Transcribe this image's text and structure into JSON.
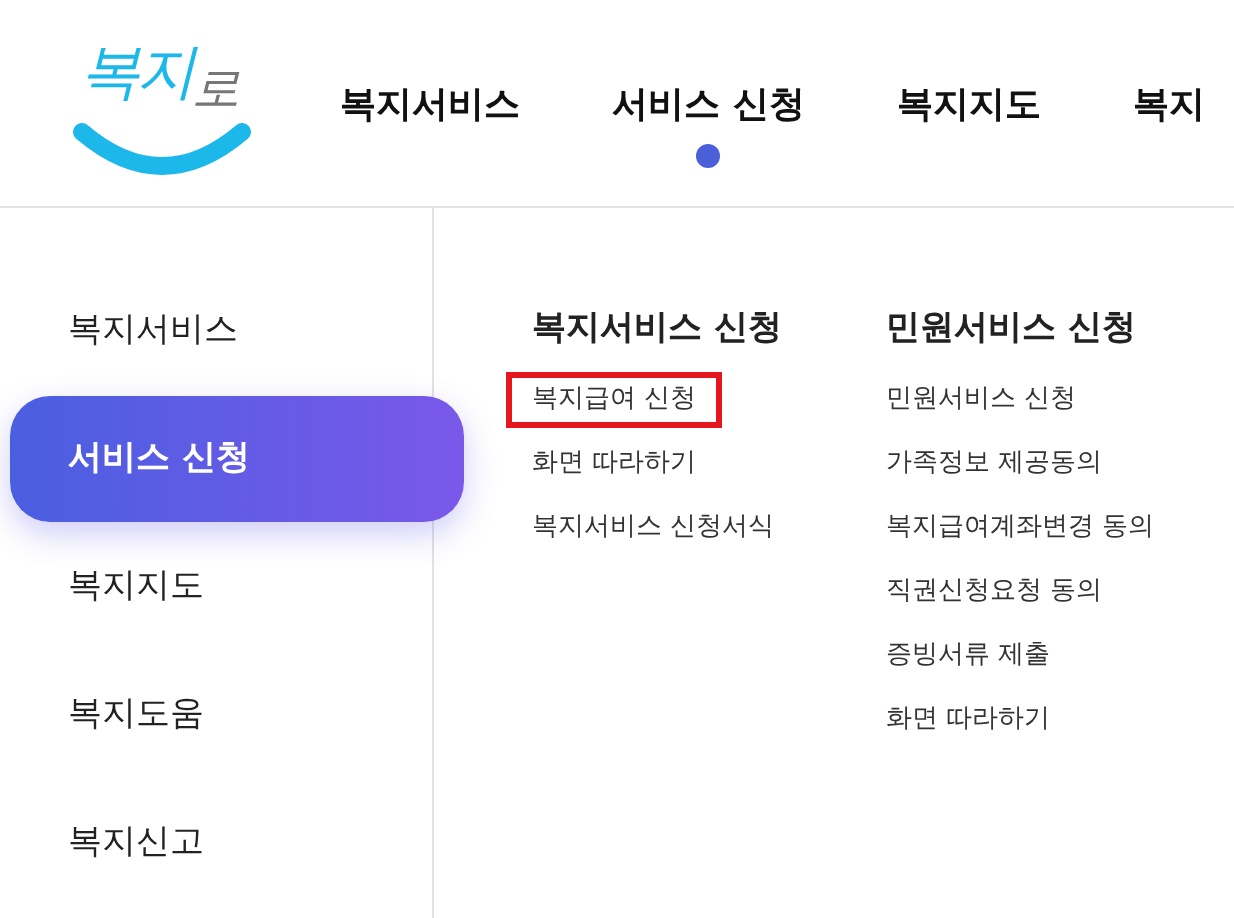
{
  "logo": {
    "text_main": "복지",
    "text_tail": "로"
  },
  "nav": [
    {
      "label": "복지서비스",
      "selected": false
    },
    {
      "label": "서비스 신청",
      "selected": true
    },
    {
      "label": "복지지도",
      "selected": false
    },
    {
      "label": "복지",
      "selected": false
    }
  ],
  "sidebar": {
    "items": [
      {
        "label": "복지서비스",
        "selected": false
      },
      {
        "label": "서비스 신청",
        "selected": true
      },
      {
        "label": "복지지도",
        "selected": false
      },
      {
        "label": "복지도움",
        "selected": false
      },
      {
        "label": "복지신고",
        "selected": false
      }
    ]
  },
  "submenu": [
    {
      "heading": "복지서비스 신청",
      "links": [
        {
          "label": "복지급여 신청",
          "highlighted": true
        },
        {
          "label": "화면 따라하기",
          "highlighted": false
        },
        {
          "label": "복지서비스 신청서식",
          "highlighted": false
        }
      ]
    },
    {
      "heading": "민원서비스 신청",
      "links": [
        {
          "label": "민원서비스 신청",
          "highlighted": false
        },
        {
          "label": "가족정보 제공동의",
          "highlighted": false
        },
        {
          "label": "복지급여계좌변경 동의",
          "highlighted": false
        },
        {
          "label": "직권신청요청 동의",
          "highlighted": false
        },
        {
          "label": "증빙서류 제출",
          "highlighted": false
        },
        {
          "label": "화면 따라하기",
          "highlighted": false
        }
      ]
    }
  ]
}
